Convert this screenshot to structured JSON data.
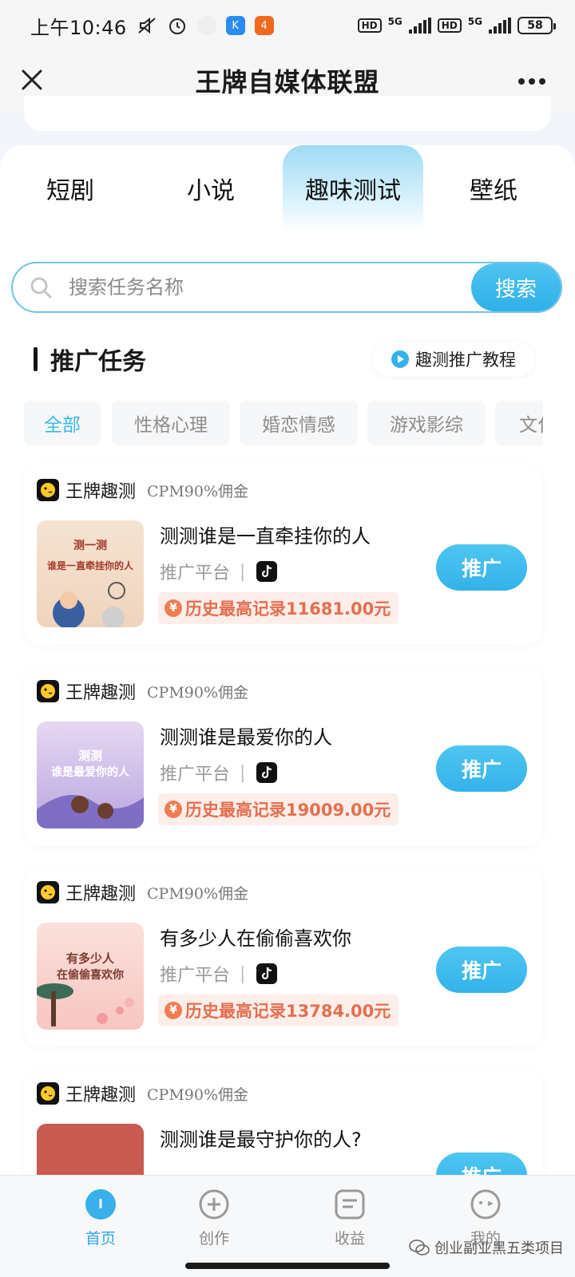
{
  "status_bar": {
    "time": "上午10:46",
    "network": "5G",
    "hd": "HD",
    "battery": "58"
  },
  "header": {
    "title": "王牌自媒体联盟"
  },
  "category_tabs": [
    {
      "label": "短剧"
    },
    {
      "label": "小说"
    },
    {
      "label": "趣味测试"
    },
    {
      "label": "壁纸"
    }
  ],
  "search": {
    "placeholder": "搜索任务名称",
    "button_label": "搜索"
  },
  "section": {
    "title": "推广任务",
    "tutorial_label": "趣测推广教程"
  },
  "filters": [
    {
      "label": "全部"
    },
    {
      "label": "性格心理"
    },
    {
      "label": "婚恋情感"
    },
    {
      "label": "游戏影综"
    },
    {
      "label": "文化"
    }
  ],
  "tasks": [
    {
      "brand": "王牌趣测",
      "commission": "CPM90%佣金",
      "title": "测测谁是一直牵挂你的人",
      "platform_label": "推广平台",
      "record": "历史最高记录11681.00元",
      "button_label": "推广",
      "thumb_line1": "测一测",
      "thumb_line2": "谁是一直牵挂你的人"
    },
    {
      "brand": "王牌趣测",
      "commission": "CPM90%佣金",
      "title": "测测谁是最爱你的人",
      "platform_label": "推广平台",
      "record": "历史最高记录19009.00元",
      "button_label": "推广",
      "thumb_line1": "测测",
      "thumb_line2": "谁是最爱你的人"
    },
    {
      "brand": "王牌趣测",
      "commission": "CPM90%佣金",
      "title": "有多少人在偷偷喜欢你",
      "platform_label": "推广平台",
      "record": "历史最高记录13784.00元",
      "button_label": "推广",
      "thumb_line1": "有多少人",
      "thumb_line2": "在偷偷喜欢你"
    },
    {
      "brand": "王牌趣测",
      "commission": "CPM90%佣金",
      "title": "测测谁是最守护你的人?",
      "button_label": "推广"
    }
  ],
  "bottom_nav": [
    {
      "label": "首页"
    },
    {
      "label": "创作"
    },
    {
      "label": "收益"
    },
    {
      "label": "我的"
    }
  ],
  "watermark": "创业副业黑五类项目",
  "colors": {
    "accent": "#33b2ea",
    "record_text": "#e46f4f",
    "record_bg": "#fdeeea"
  }
}
